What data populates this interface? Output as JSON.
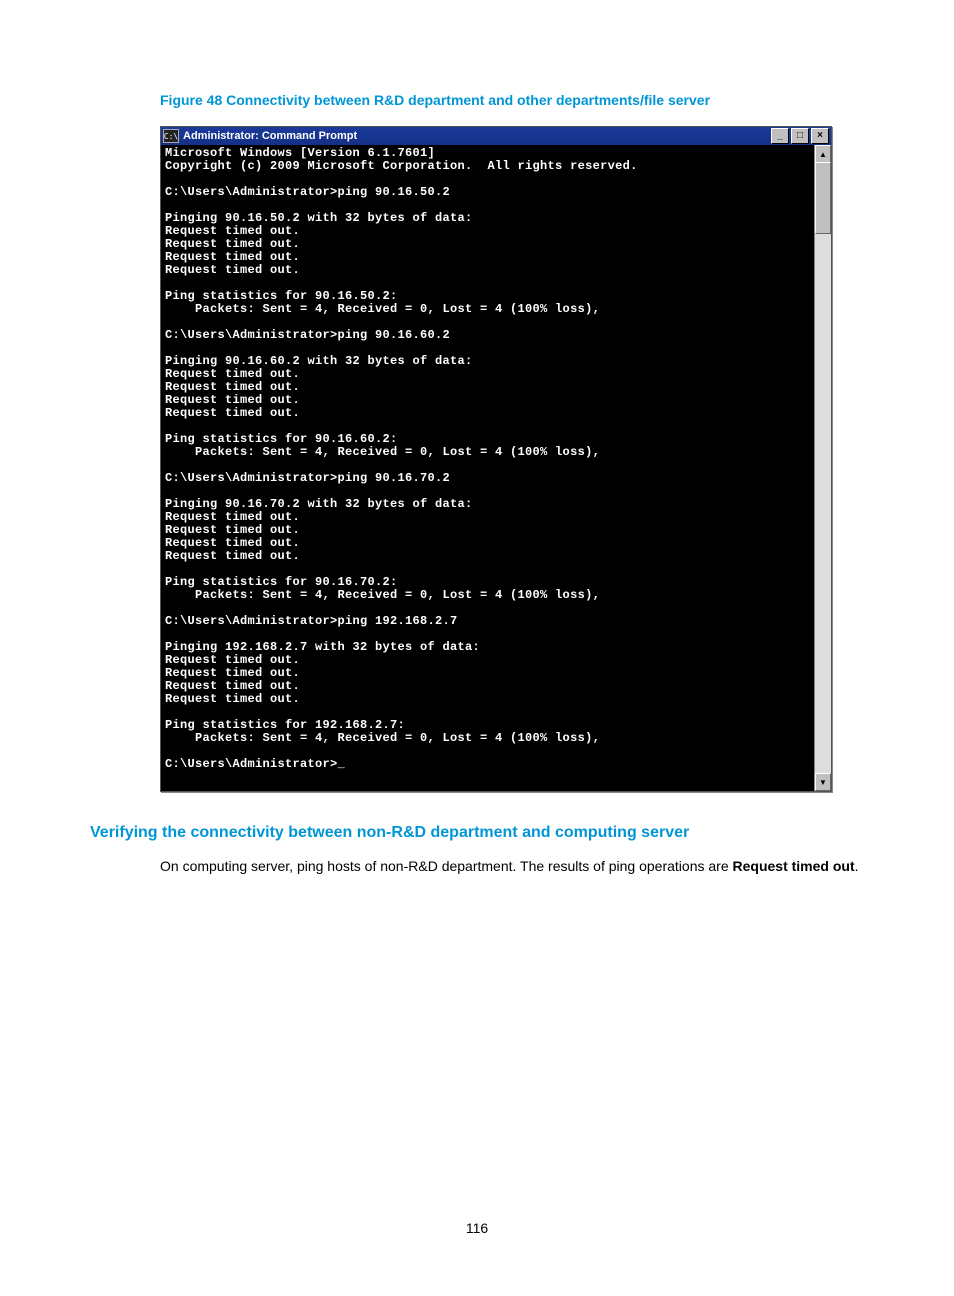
{
  "figure_caption": "Figure 48 Connectivity between R&D department and other departments/file server",
  "titlebar": {
    "icon_text": "C:\\",
    "title": "Administrator: Command Prompt",
    "min_label": "_",
    "max_label": "□",
    "close_label": "×"
  },
  "console_lines": [
    "Microsoft Windows [Version 6.1.7601]",
    "Copyright (c) 2009 Microsoft Corporation.  All rights reserved.",
    "",
    "C:\\Users\\Administrator>ping 90.16.50.2",
    "",
    "Pinging 90.16.50.2 with 32 bytes of data:",
    "Request timed out.",
    "Request timed out.",
    "Request timed out.",
    "Request timed out.",
    "",
    "Ping statistics for 90.16.50.2:",
    "    Packets: Sent = 4, Received = 0, Lost = 4 (100% loss),",
    "",
    "C:\\Users\\Administrator>ping 90.16.60.2",
    "",
    "Pinging 90.16.60.2 with 32 bytes of data:",
    "Request timed out.",
    "Request timed out.",
    "Request timed out.",
    "Request timed out.",
    "",
    "Ping statistics for 90.16.60.2:",
    "    Packets: Sent = 4, Received = 0, Lost = 4 (100% loss),",
    "",
    "C:\\Users\\Administrator>ping 90.16.70.2",
    "",
    "Pinging 90.16.70.2 with 32 bytes of data:",
    "Request timed out.",
    "Request timed out.",
    "Request timed out.",
    "Request timed out.",
    "",
    "Ping statistics for 90.16.70.2:",
    "    Packets: Sent = 4, Received = 0, Lost = 4 (100% loss),",
    "",
    "C:\\Users\\Administrator>ping 192.168.2.7",
    "",
    "Pinging 192.168.2.7 with 32 bytes of data:",
    "Request timed out.",
    "Request timed out.",
    "Request timed out.",
    "Request timed out.",
    "",
    "Ping statistics for 192.168.2.7:",
    "    Packets: Sent = 4, Received = 0, Lost = 4 (100% loss),",
    "",
    "C:\\Users\\Administrator>_"
  ],
  "section_heading": "Verifying the connectivity between non-R&D department and computing server",
  "body": {
    "pre": "On computing server, ping hosts of non-R&D department. The results of ping operations are ",
    "bold": "Request timed out",
    "post": "."
  },
  "page_number": "116",
  "scroll": {
    "up": "▲",
    "down": "▼"
  }
}
